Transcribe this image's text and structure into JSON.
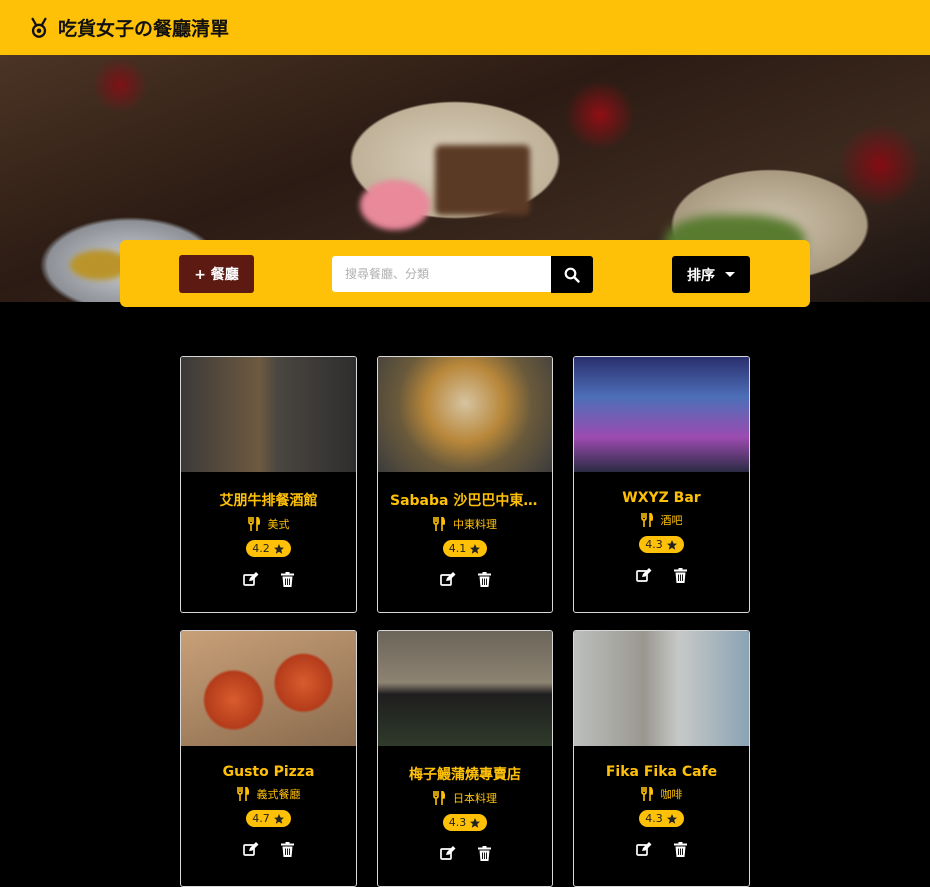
{
  "brand": {
    "title": "吃貨女子の餐廳清單",
    "icon": "medal-icon"
  },
  "toolbar": {
    "add_label": "+ 餐廳",
    "search_placeholder": "搜尋餐廳、分類",
    "search_value": "",
    "sort_label": "排序"
  },
  "restaurants": [
    {
      "name": "艾朋牛排餐酒館",
      "category": "美式",
      "rating": "4.2"
    },
    {
      "name": "Sababa 沙巴巴中東美食",
      "category": "中東料理",
      "rating": "4.1"
    },
    {
      "name": "WXYZ Bar",
      "category": "酒吧",
      "rating": "4.3"
    },
    {
      "name": "Gusto Pizza",
      "category": "義式餐廳",
      "rating": "4.7"
    },
    {
      "name": "梅子鰻蒲燒專賣店",
      "category": "日本料理",
      "rating": "4.3"
    },
    {
      "name": "Fika Fika Cafe",
      "category": "咖啡",
      "rating": "4.3"
    }
  ],
  "colors": {
    "accent": "#ffc107",
    "add_button": "#5c1a13",
    "background": "#000000"
  }
}
